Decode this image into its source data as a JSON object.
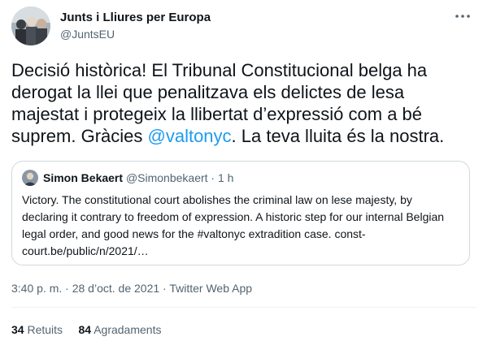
{
  "author": {
    "name": "Junts i Lliures per Europa",
    "handle": "@JuntsEU"
  },
  "tweet": {
    "text_before": "Decisió històrica! El Tribunal Constitucional belga ha derogat la llei que penalitzava els delictes de lesa majestat i protegeix la llibertat d’expressió com a bé suprem. Gràcies ",
    "mention": "@valtonyc",
    "text_after": ". La teva lluita és la nostra."
  },
  "quote": {
    "name": "Simon Bekaert",
    "handle": "@Simonbekaert",
    "separator": "·",
    "time": "1 h",
    "text": "Victory. The constitutional court abolishes the criminal law on lese majesty, by declaring it contrary to freedom of expression. A historic step for our internal Belgian legal order, and good news for the #valtonyc extradition case. const-court.be/public/n/2021/…"
  },
  "meta": {
    "time": "3:40 p. m.",
    "separator": "·",
    "date": "28 d’oct. de 2021",
    "source": "Twitter Web App"
  },
  "stats": {
    "retweets_count": "34",
    "retweets_label": "Retuits",
    "likes_count": "84",
    "likes_label": "Agradaments"
  },
  "icons": {
    "more": "more-horizontal-icon"
  },
  "colors": {
    "accent": "#1d9bf0",
    "text": "#0f1419",
    "secondary": "#536471",
    "border": "#cfd9de"
  }
}
